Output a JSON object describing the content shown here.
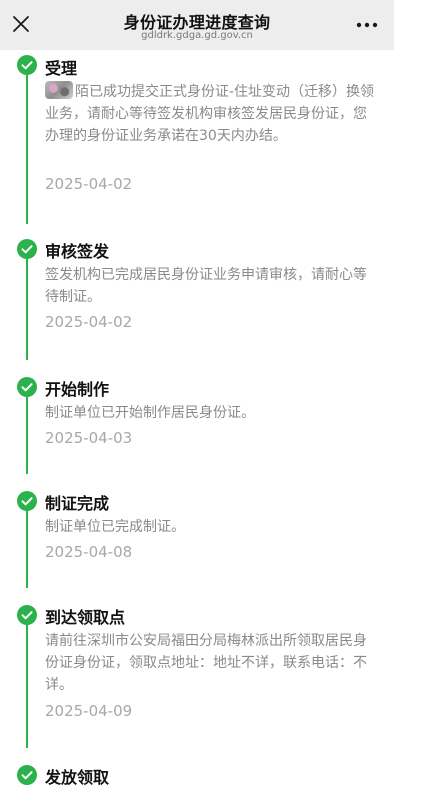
{
  "header": {
    "title": "身份证办理进度查询",
    "url": "gdldrk.gdga.gd.gov.cn"
  },
  "colors": {
    "accent": "#2bb24c",
    "header_bg": "#ededed",
    "desc": "#8a8a8a",
    "date": "#a8a8a8"
  },
  "steps": [
    {
      "title": "受理",
      "desc": "陌已成功提交正式身份证-住址变动（迁移）换领业务，请耐心等待签发机构审核签发居民身份证，您办理的身份证业务承诺在30天内办结。",
      "date": "2025-04-02"
    },
    {
      "title": "审核签发",
      "desc": "签发机构已完成居民身份证业务申请审核，请耐心等待制证。",
      "date": "2025-04-02"
    },
    {
      "title": "开始制作",
      "desc": "制证单位已开始制作居民身份证。",
      "date": "2025-04-03"
    },
    {
      "title": "制证完成",
      "desc": "制证单位已完成制证。",
      "date": "2025-04-08"
    },
    {
      "title": "到达领取点",
      "desc": "请前往深圳市公安局福田分局梅林派出所领取居民身份证身份证，领取点地址：地址不详，联系电话：不详。",
      "date": "2025-04-09"
    },
    {
      "title": "发放领取"
    }
  ]
}
